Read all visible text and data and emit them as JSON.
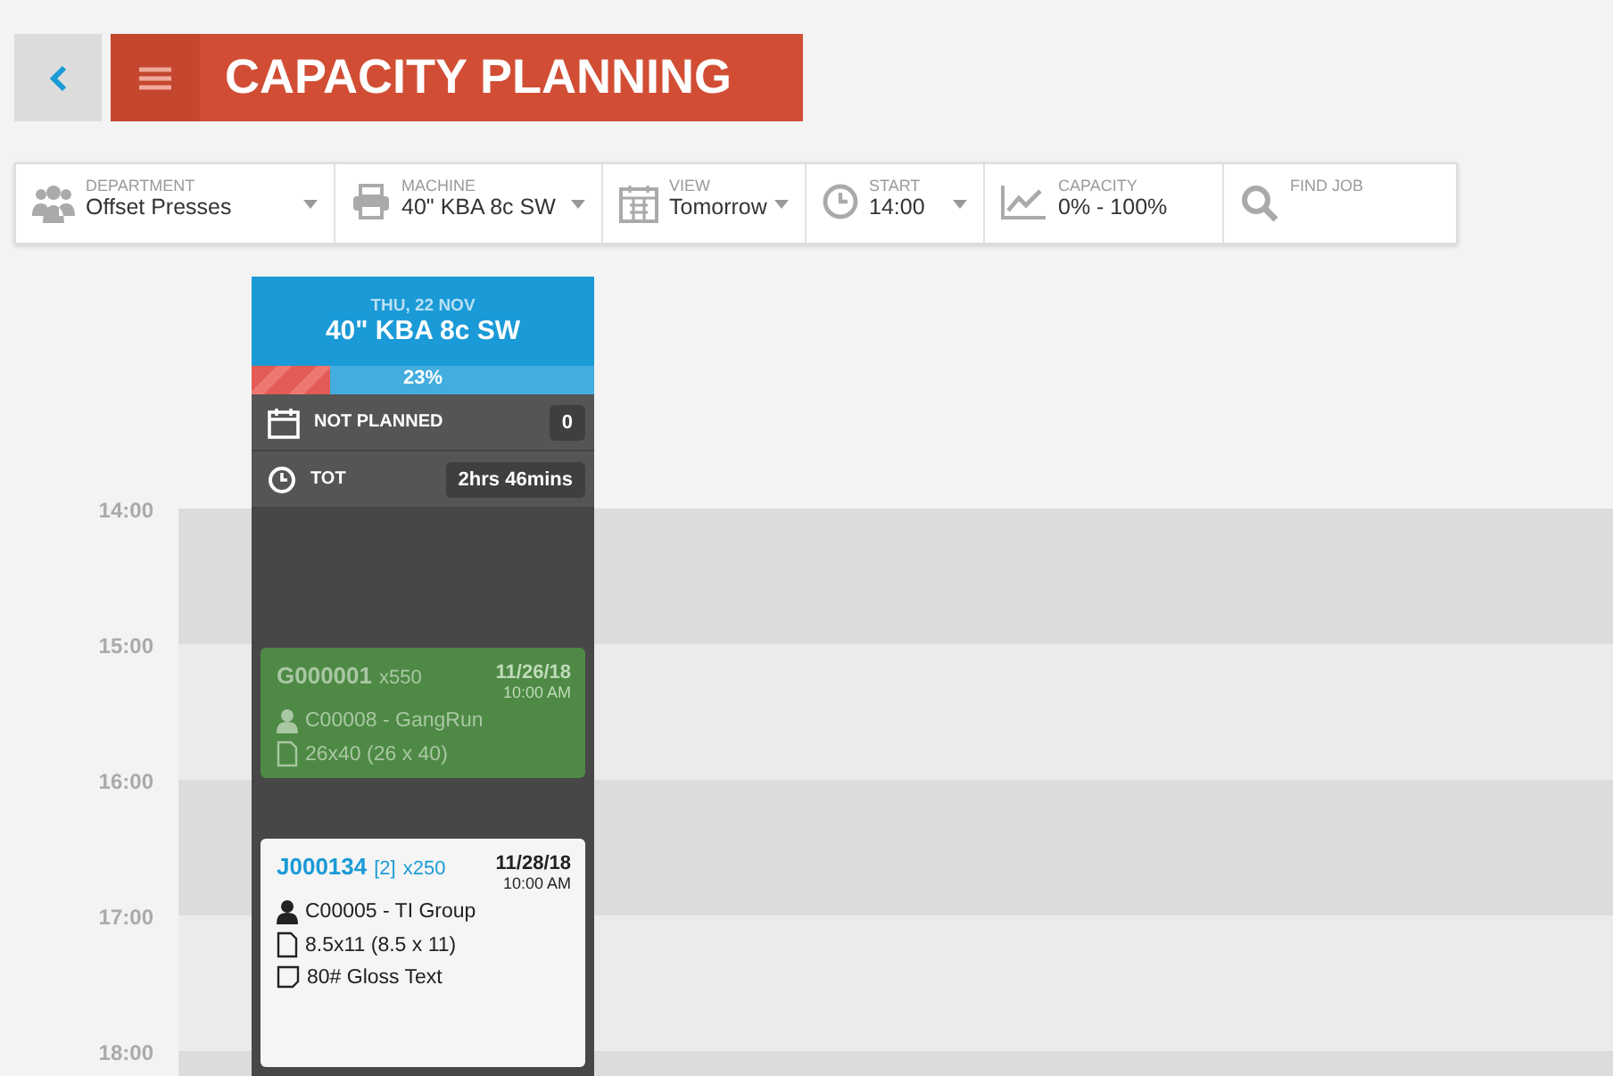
{
  "header": {
    "title": "CAPACITY PLANNING"
  },
  "filters": [
    {
      "kind": "department",
      "label": "DEPARTMENT",
      "value": "Offset Presses",
      "dropdown": true
    },
    {
      "kind": "machine",
      "label": "MACHINE",
      "value": "40\" KBA 8c SW",
      "dropdown": true
    },
    {
      "kind": "view",
      "label": "VIEW",
      "value": "Tomorrow",
      "dropdown": true
    },
    {
      "kind": "start",
      "label": "START",
      "value": "14:00",
      "dropdown": true
    },
    {
      "kind": "capacity",
      "label": "CAPACITY",
      "value": "0% - 100%",
      "dropdown": false
    },
    {
      "kind": "find",
      "label": "FIND JOB",
      "dropdown": false
    }
  ],
  "times": [
    "14:00",
    "15:00",
    "16:00",
    "17:00",
    "18:00"
  ],
  "column": {
    "date": "THU, 22 NOV",
    "machine": "40\" KBA 8c SW",
    "capacity": {
      "level": 0.23,
      "reading": "23%"
    },
    "stats": [
      {
        "kind": "not_planned",
        "label": "NOT PLANNED",
        "value": "0"
      },
      {
        "kind": "tot",
        "label": "TOT",
        "value": "2hrs 46mins"
      }
    ],
    "jobs": [
      {
        "kind": "gangrun",
        "id": "G000001",
        "quantity": "x550",
        "date": "11/26/18",
        "time": "10:00 AM",
        "lines": [
          {
            "kind": "customer",
            "text": "C00008 - GangRun"
          },
          {
            "kind": "size",
            "text": "26x40 (26 x 40)"
          }
        ]
      },
      {
        "kind": "job",
        "id": "J000134",
        "qualifier": "[2]",
        "quantity": "x250",
        "date": "11/28/18",
        "time": "10:00 AM",
        "lines": [
          {
            "kind": "customer",
            "text": "C00005 - TI Group"
          },
          {
            "kind": "size",
            "text": "8.5x11 (8.5 x 11)"
          },
          {
            "kind": "stock",
            "text": "80# Gloss Text"
          }
        ]
      }
    ]
  }
}
